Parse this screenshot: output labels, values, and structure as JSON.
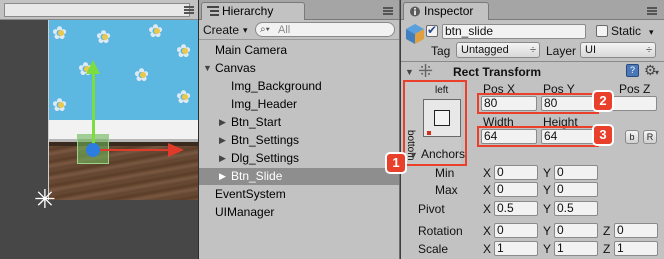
{
  "scene": {},
  "hierarchy": {
    "tab_label": "Hierarchy",
    "create_label": "Create",
    "search_placeholder": "All",
    "items": [
      {
        "label": "Main Camera",
        "indent": 0,
        "expander": ""
      },
      {
        "label": "Canvas",
        "indent": 0,
        "expander": "▼"
      },
      {
        "label": "Img_Background",
        "indent": 1,
        "expander": ""
      },
      {
        "label": "Img_Header",
        "indent": 1,
        "expander": ""
      },
      {
        "label": "Btn_Start",
        "indent": 1,
        "expander": "▶"
      },
      {
        "label": "Btn_Settings",
        "indent": 1,
        "expander": "▶"
      },
      {
        "label": "Dlg_Settings",
        "indent": 1,
        "expander": "▶"
      },
      {
        "label": "Btn_Slide",
        "indent": 1,
        "expander": "▶",
        "selected": true
      },
      {
        "label": "EventSystem",
        "indent": 0,
        "expander": ""
      },
      {
        "label": "UIManager",
        "indent": 0,
        "expander": ""
      }
    ]
  },
  "inspector": {
    "tab_label": "Inspector",
    "object_name": "btn_slide",
    "static_label": "Static",
    "tag_label": "Tag",
    "tag_value": "Untagged",
    "layer_label": "Layer",
    "layer_value": "UI",
    "component_title": "Rect Transform",
    "anchor_h_label": "left",
    "anchor_v_label": "bottom",
    "anchors_label": "Anchors",
    "posx_label": "Pos X",
    "posy_label": "Pos Y",
    "posz_label": "Pos Z",
    "posx": "80",
    "posy": "80",
    "posz": "",
    "width_label": "Width",
    "height_label": "Height",
    "width": "64",
    "height": "64",
    "blueprint_btn": "b",
    "raw_btn": "R",
    "min_label": "Min",
    "max_label": "Max",
    "pivot_label": "Pivot",
    "rotation_label": "Rotation",
    "scale_label": "Scale",
    "x": "X",
    "y": "Y",
    "z": "Z",
    "min_x": "0",
    "min_y": "0",
    "max_x": "0",
    "max_y": "0",
    "pivot_x": "0.5",
    "pivot_y": "0.5",
    "rot_x": "0",
    "rot_y": "0",
    "rot_z": "0",
    "scale_x": "1",
    "scale_y": "1",
    "scale_z": "1"
  },
  "callouts": [
    "1",
    "2",
    "3"
  ],
  "colors": {
    "callout": "#e8402a",
    "selection": "#8e8e8e",
    "panel": "#c2c2c2"
  }
}
